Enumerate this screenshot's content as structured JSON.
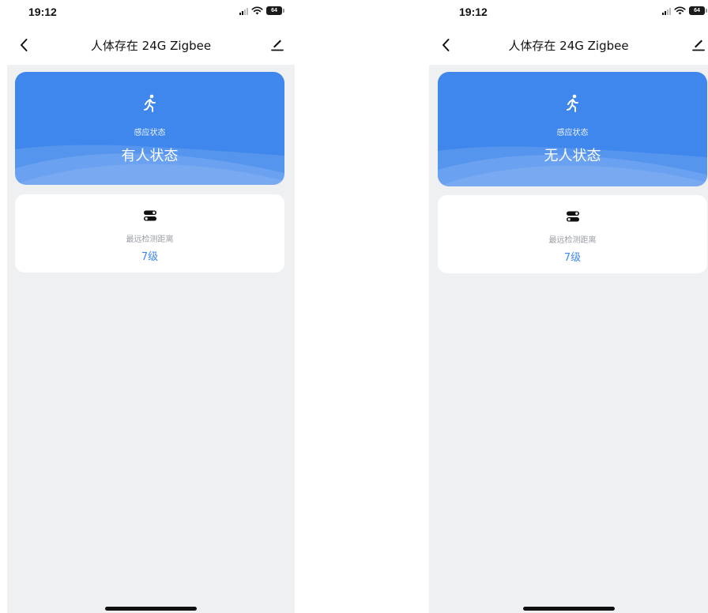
{
  "screens": [
    {
      "status_time": "19:12",
      "battery_level": "64",
      "nav_title": "人体存在 24G Zigbee",
      "sense_label": "感应状态",
      "state_value": "有人状态",
      "distance_label": "最远检测距离",
      "distance_value": "7级"
    },
    {
      "status_time": "19:12",
      "battery_level": "64",
      "nav_title": "人体存在 24G Zigbee",
      "sense_label": "感应状态",
      "state_value": "无人状态",
      "distance_label": "最远检测距离",
      "distance_value": "7级"
    }
  ],
  "icons": {
    "back": "chevron-left-icon",
    "edit": "pencil-icon",
    "presence": "running-person-icon",
    "distance": "toggle-switch-icon",
    "signal": "signal-bars-icon",
    "wifi": "wifi-icon",
    "battery": "battery-icon"
  },
  "colors": {
    "accent": "#3f87ec",
    "background": "#eff0f2",
    "card": "#ffffff",
    "muted_text": "#9a9ea5"
  }
}
